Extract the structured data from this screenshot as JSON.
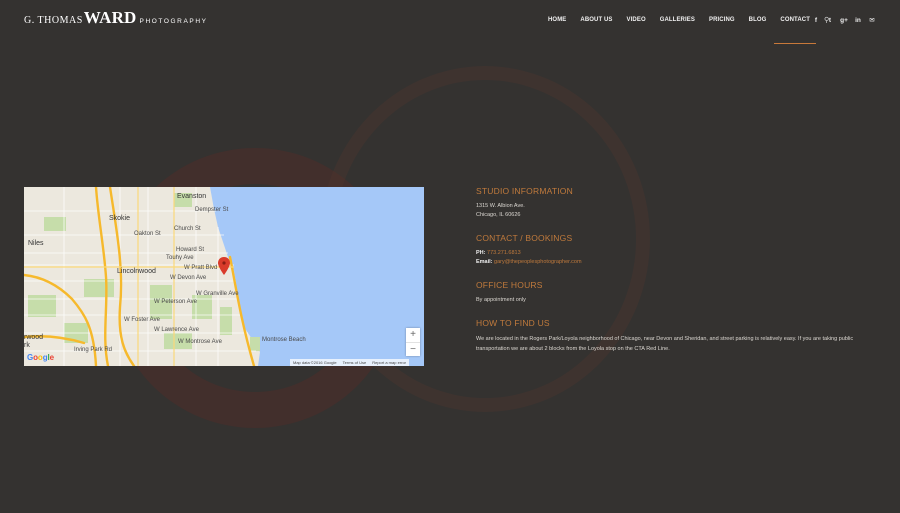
{
  "logo": {
    "first": "G. THOMAS",
    "last": "WARD",
    "tagline": "PHOTOGRAPHY"
  },
  "nav": {
    "items": [
      {
        "id": "home",
        "label": "HOME"
      },
      {
        "id": "about",
        "label": "ABOUT US"
      },
      {
        "id": "video",
        "label": "VIDEO"
      },
      {
        "id": "galleries",
        "label": "GALLERIES"
      },
      {
        "id": "pricing",
        "label": "PRICING"
      },
      {
        "id": "blog",
        "label": "BLOG"
      },
      {
        "id": "contact",
        "label": "CONTACT"
      }
    ],
    "active": "contact",
    "search_glyph": "⚲"
  },
  "social": [
    {
      "name": "facebook-icon",
      "glyph": "f"
    },
    {
      "name": "twitter-icon",
      "glyph": "t"
    },
    {
      "name": "google-plus-icon",
      "glyph": "g+"
    },
    {
      "name": "linkedin-icon",
      "glyph": "in"
    },
    {
      "name": "mail-icon",
      "glyph": "✉"
    }
  ],
  "map": {
    "labels": {
      "evanston": "Evanston",
      "skokie": "Skokie",
      "niles": "Niles",
      "lincolnwood": "Lincolnwood",
      "wood": "rwood",
      "rk": "rk",
      "touhy": "Touhy Ave",
      "pratt": "W Pratt Blvd",
      "devon": "W Devon Ave",
      "granville": "W Granville Ave",
      "peterson": "W Peterson Ave",
      "foster": "W Foster Ave",
      "howard": "Howard St",
      "dempster": "Dempster St",
      "oakton": "Oakton St",
      "church": "Church St",
      "irving": "Irving Park Rd",
      "lawrence": "W Lawrence Ave",
      "montrose": "W Montrose Ave",
      "montrose_beach": "Montrose Beach"
    },
    "zoom_in": "+",
    "zoom_out": "−",
    "attribution": [
      "Map data ©2016 Google",
      "Terms of Use",
      "Report a map error"
    ],
    "colors": {
      "water": "#a5c8f8",
      "land": "#ece8de",
      "highway": "#f6b92c",
      "park": "#c6ddaa",
      "pin": "#d93b2b"
    }
  },
  "studio": {
    "title": "STUDIO INFORMATION",
    "address1": "1315 W. Albion Ave.",
    "address2": "Chicago, IL 60626"
  },
  "contact": {
    "title": "CONTACT / BOOKINGS",
    "phone_label": "PH:",
    "phone": "773.271.6813",
    "email_label": "Email:",
    "email": "gary@thepeoplesphotographer.com"
  },
  "hours": {
    "title": "OFFICE HOURS",
    "text": "By appointment only"
  },
  "find": {
    "title": "HOW TO FIND US",
    "text": "We are located in the Rogers Park/Loyola neighborhood of Chicago, near Devon and Sheridan, and street parking is relatively easy. If you are taking public transportation we are about 2 blocks from the Loyola stop on the CTA Red Line."
  },
  "colors": {
    "background": "#343230",
    "accent": "#c07a3c"
  }
}
